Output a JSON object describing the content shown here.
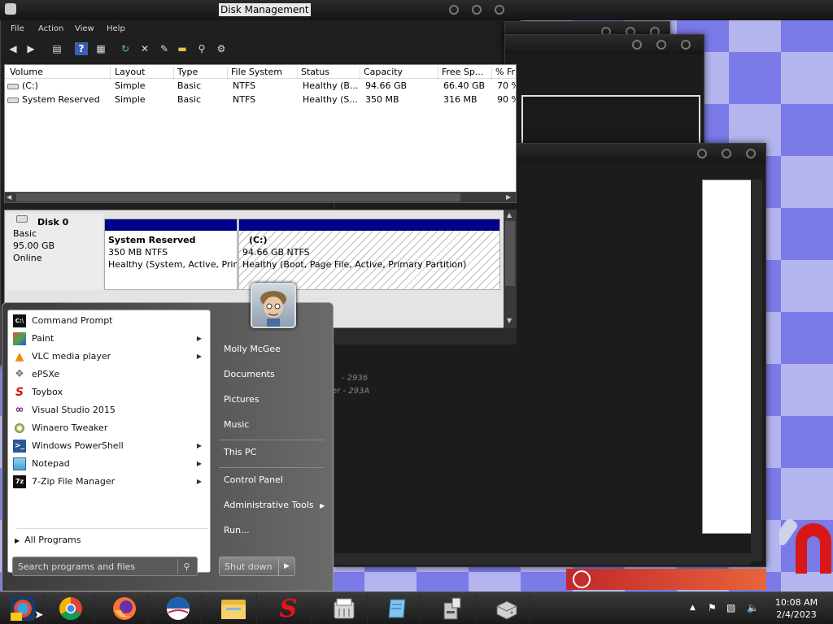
{
  "disk_management": {
    "title": "Disk Management",
    "menu": [
      "File",
      "Action",
      "View",
      "Help"
    ],
    "columns": [
      "Volume",
      "Layout",
      "Type",
      "File System",
      "Status",
      "Capacity",
      "Free Sp...",
      "% Fr"
    ],
    "rows": [
      [
        "(C:)",
        "Simple",
        "Basic",
        "NTFS",
        "Healthy (B...",
        "94.66 GB",
        "66.40 GB",
        "70 %"
      ],
      [
        "System Reserved",
        "Simple",
        "Basic",
        "NTFS",
        "Healthy (S...",
        "350 MB",
        "316 MB",
        "90 %"
      ]
    ],
    "disk": {
      "name": "Disk 0",
      "type": "Basic",
      "size": "95.00 GB",
      "state": "Online"
    },
    "partitions": [
      {
        "name": "System Reserved",
        "size": "350 MB NTFS",
        "status": "Healthy (System, Active, Prin"
      },
      {
        "name": "(C:)",
        "size": "94.66 GB NTFS",
        "status": "Healthy (Boot, Page File, Active, Primary Partition)"
      }
    ]
  },
  "background_text": [
    "- 2936",
    "er - 293A"
  ],
  "start_menu": {
    "programs": [
      {
        "label": "Command Prompt",
        "icon": "cmd-icon",
        "arrow": false
      },
      {
        "label": "Paint",
        "icon": "paint-icon",
        "arrow": true
      },
      {
        "label": "VLC media player",
        "icon": "vlc-icon",
        "arrow": true
      },
      {
        "label": "ePSXe",
        "icon": "gamepad-icon",
        "arrow": false
      },
      {
        "label": "Toybox",
        "icon": "toybox-icon",
        "arrow": false
      },
      {
        "label": "Visual Studio 2015",
        "icon": "visual-studio-icon",
        "arrow": false
      },
      {
        "label": "Winaero Tweaker",
        "icon": "winaero-icon",
        "arrow": false
      },
      {
        "label": "Windows PowerShell",
        "icon": "powershell-icon",
        "arrow": true
      },
      {
        "label": "Notepad",
        "icon": "notepad-icon",
        "arrow": true
      },
      {
        "label": "7-Zip File Manager",
        "icon": "7zip-icon",
        "arrow": true
      }
    ],
    "all_programs": "All Programs",
    "search_placeholder": "Search programs and files",
    "right": {
      "user": "Molly McGee",
      "documents": "Documents",
      "pictures": "Pictures",
      "music": "Music",
      "this_pc": "This PC",
      "control_panel": "Control Panel",
      "admin_tools": "Administrative Tools",
      "run": "Run..."
    },
    "shutdown": "Shut down"
  },
  "taskbar": {
    "time": "10:08 AM",
    "date": "2/4/2023",
    "apps": [
      "start-orb-icon",
      "chrome-icon",
      "firefox-icon",
      "obama-logo-icon",
      "file-explorer-icon",
      "toybox-icon",
      "shredder-icon",
      "notepad-icon",
      "disk-tool-icon",
      "hard-drive-icon"
    ]
  },
  "colors": {
    "partition_header": "#00008b",
    "window_dark": "#1c1c1c",
    "desktop_blue": "#7a7ae8"
  }
}
